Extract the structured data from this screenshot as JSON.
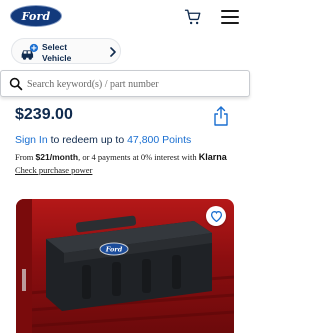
{
  "header": {
    "logo_text": "Ford",
    "cart_icon": "shopping-cart-icon",
    "menu_icon": "hamburger-menu-icon"
  },
  "vehicle_selector": {
    "label_line1": "Select",
    "label_line2": "Vehicle",
    "icon": "car-plus-icon"
  },
  "search": {
    "placeholder": "Search keyword(s) / part number",
    "value": ""
  },
  "product": {
    "price": "$239.00",
    "points": {
      "sign_in": "Sign In",
      "middle": " to redeem up to ",
      "points_value": "47,800 Points"
    },
    "financing": {
      "prefix": "From ",
      "monthly": "$21/month",
      "middle": ", or 4 payments at 0% interest with ",
      "provider": "Klarna"
    },
    "check_power_link": "Check purchase power",
    "image_alt": "Ford truck bed tool box",
    "badge_text": "Ford"
  },
  "colors": {
    "brand_blue": "#133a7c",
    "link_blue": "#1a6fd1",
    "text_navy": "#102b4e",
    "truck_red": "#a01214"
  }
}
